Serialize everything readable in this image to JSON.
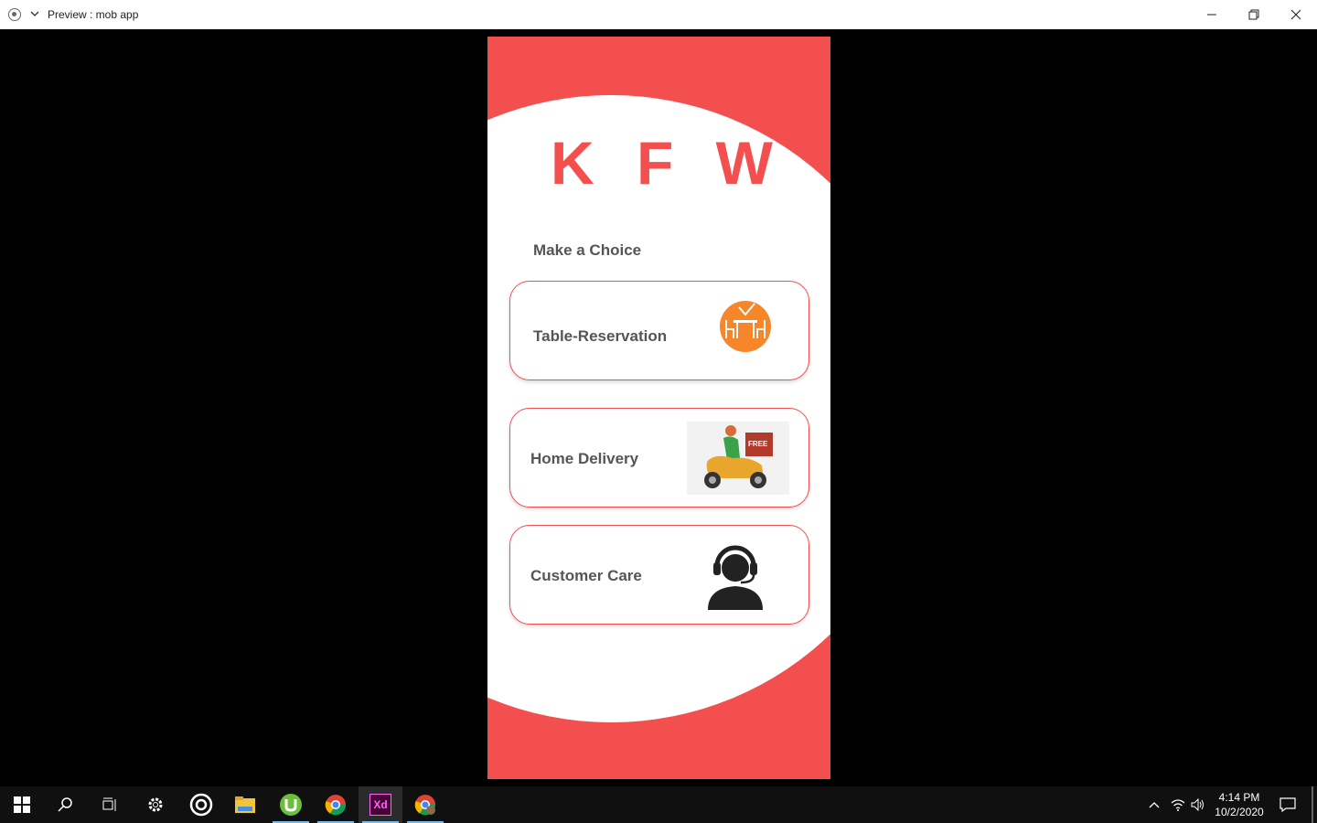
{
  "window": {
    "title": "Preview : mob app"
  },
  "app": {
    "brand": "K F W",
    "heading": "Make a Choice",
    "options": [
      {
        "label": "Table-Reservation",
        "icon": "table-reservation-icon"
      },
      {
        "label": "Home Delivery",
        "icon": "delivery-scooter-icon",
        "image_text": "FREE"
      },
      {
        "label": "Customer Care",
        "icon": "customer-care-headset-icon"
      }
    ]
  },
  "taskbar": {
    "clock_time": "4:14 PM",
    "clock_date": "10/2/2020",
    "xd_label": "Xd"
  },
  "colors": {
    "accent": "#f44f4f",
    "text": "#555555",
    "icon_orange": "#f7862a"
  }
}
